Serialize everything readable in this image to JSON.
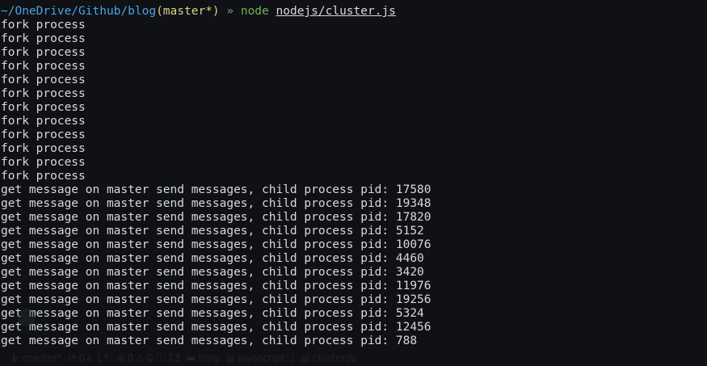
{
  "prompt": {
    "path": "~/OneDrive/Github/blog",
    "branch": "(master*)",
    "arrow": " » ",
    "command": "node",
    "file": "nodejs/cluster.js"
  },
  "output_lines": [
    "fork process",
    "fork process",
    "fork process",
    "fork process",
    "fork process",
    "fork process",
    "fork process",
    "fork process",
    "fork process",
    "fork process",
    "fork process",
    "fork process",
    "get message on master send messages, child process pid: 17580",
    "get message on master send messages, child process pid: 19348",
    "get message on master send messages, child process pid: 17820",
    "get message on master send messages, child process pid: 5152",
    "get message on master send messages, child process pid: 10076",
    "get message on master send messages, child process pid: 4460",
    "get message on master send messages, child process pid: 3420",
    "get message on master send messages, child process pid: 11976",
    "get message on master send messages, child process pid: 19256",
    "get message on master send messages, child process pid: 5324",
    "get message on master send messages, child process pid: 12456",
    "get message on master send messages, child process pid: 788"
  ],
  "status_bar": {
    "branch_label": "master*",
    "sync_label": "0↓ 1↑",
    "errors": "0",
    "warnings": "0",
    "info": "13",
    "folder": "blog",
    "language": "javascript",
    "file": "cluster.js",
    "icons": [
      "git-branch-icon",
      "sync-icon",
      "error-icon",
      "warning-icon",
      "info-icon",
      "folder-icon",
      "file-icon"
    ]
  }
}
